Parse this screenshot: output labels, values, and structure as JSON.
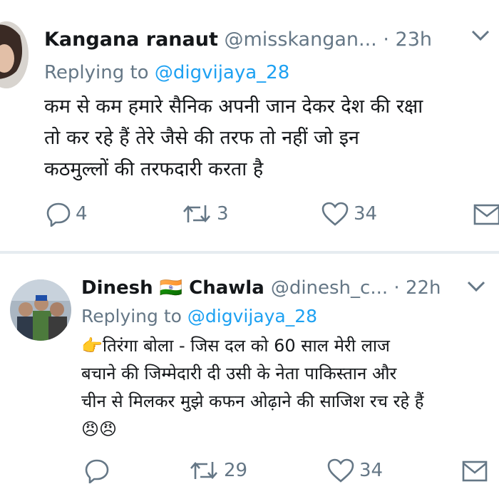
{
  "tweets": [
    {
      "name": "Kangana ranaut",
      "handle": "@misskangan...",
      "separator": "·",
      "time": "23h",
      "replying_prefix": "Replying to",
      "replying_to": "@digvijaya_28",
      "lines": [
        "कम से कम हमारे सैनिक अपनी जान देकर देश की रक्षा",
        "तो कर रहे हैं तेरे जैसे  की तरफ तो नहीं जो इन",
        "कठमुल्लों की तरफदारी करता है"
      ],
      "reply_count": "4",
      "retweet_count": "3",
      "like_count": "34"
    },
    {
      "name_first": "Dinesh",
      "name_flag": "🇮🇳",
      "name_last": "Chawla",
      "handle": "@dinesh_c...",
      "separator": "·",
      "time": "22h",
      "replying_prefix": "Replying to",
      "replying_to": "@digvijaya_28",
      "lines": [
        "👉तिरंगा बोला - जिस दल को 60 साल मेरी लाज",
        "बचाने की जिम्मेदारी दी उसी के नेता पाकिस्तान और",
        "चीन से मिलकर मुझे कफन ओढ़ाने की साजिश रच रहे हैं",
        "😠😠"
      ],
      "reply_count": "",
      "retweet_count": "29",
      "like_count": "34"
    }
  ],
  "icons": {
    "reply": "reply-icon",
    "retweet": "retweet-icon",
    "like": "heart-icon",
    "dm": "mail-icon",
    "more": "chevron-down-icon"
  },
  "colors": {
    "text": "#14171a",
    "secondary": "#657786",
    "link": "#1da1f2",
    "divider": "#e6ecf0"
  }
}
